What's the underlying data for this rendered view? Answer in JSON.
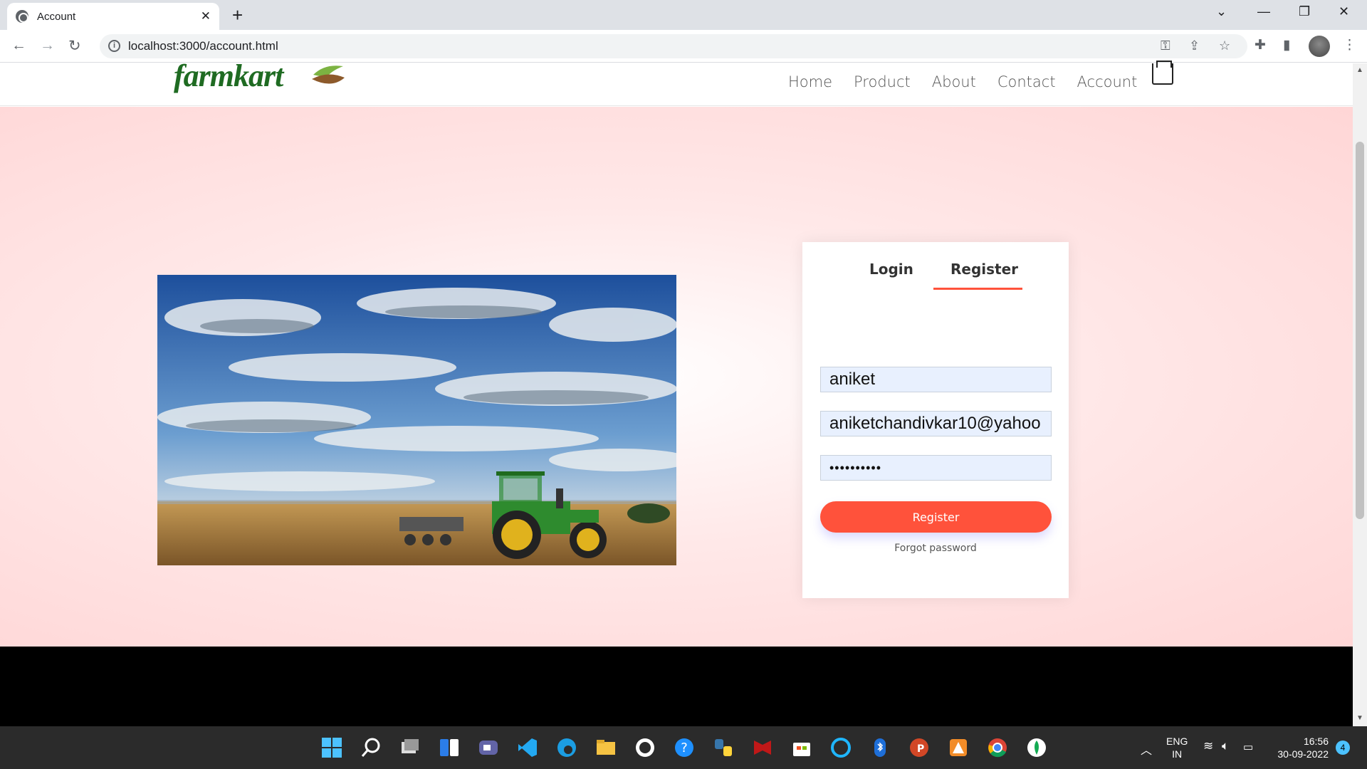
{
  "browser": {
    "tab_title": "Account",
    "tab_close_icon": "close-icon",
    "new_tab_icon": "plus-icon",
    "url": "localhost:3000/account.html"
  },
  "site": {
    "logo_text": "farmkart",
    "nav": [
      "Home",
      "Product",
      "About",
      "Contact",
      "Account"
    ],
    "cart_icon": "cart-icon"
  },
  "form": {
    "tabs": {
      "login": "Login",
      "register": "Register",
      "active": "Register"
    },
    "username_value": "aniket",
    "email_value": "aniketchandivkar10@yahoo",
    "password_value": "••••••••••",
    "submit_label": "Register",
    "forgot_label": "Forgot password"
  },
  "taskbar": {
    "language": "ENG",
    "region": "IN",
    "time": "16:56",
    "date": "30-09-2022",
    "notification_count": "4"
  },
  "colors": {
    "accent": "#ff523b",
    "logo_green": "#1f6b22",
    "hero_pink": "#ffd6d6"
  }
}
